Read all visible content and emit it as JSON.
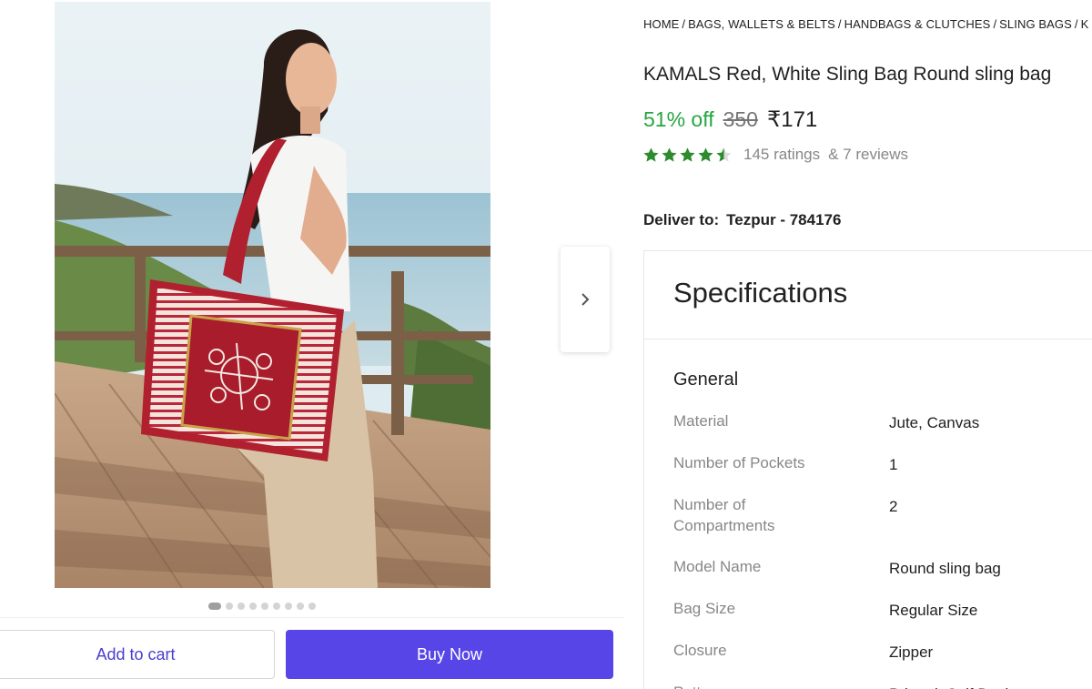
{
  "breadcrumb": [
    "HOME",
    "BAGS, WALLETS & BELTS",
    "HANDBAGS & CLUTCHES",
    "SLING BAGS",
    "K"
  ],
  "breadcrumb_sep": "/",
  "product": {
    "title": "KAMALS Red, White Sling Bag Round sling bag",
    "discount": "51% off",
    "mrp": "350",
    "price": "₹171",
    "rating_stars": 4.5,
    "ratings_text": "145 ratings",
    "reviews_text": "& 7 reviews"
  },
  "delivery": {
    "label": "Deliver to:",
    "location": "Tezpur - 784176"
  },
  "gallery": {
    "image_count": 9,
    "active_index": 0
  },
  "actions": {
    "add_to_cart": "Add to cart",
    "buy_now": "Buy Now"
  },
  "specifications": {
    "heading": "Specifications",
    "section": "General",
    "rows": [
      {
        "label": "Material",
        "value": "Jute, Canvas"
      },
      {
        "label": "Number of Pockets",
        "value": "1"
      },
      {
        "label": "Number of\nCompartments",
        "value": "2"
      },
      {
        "label": "Model Name",
        "value": "Round sling bag"
      },
      {
        "label": "Bag Size",
        "value": "Regular Size"
      },
      {
        "label": "Closure",
        "value": "Zipper"
      },
      {
        "label": "Pattern",
        "value": "Printed, Self Design"
      }
    ]
  },
  "colors": {
    "accent": "#5745e8",
    "discount_green": "#26a541",
    "star_green": "#2c8c2c"
  }
}
